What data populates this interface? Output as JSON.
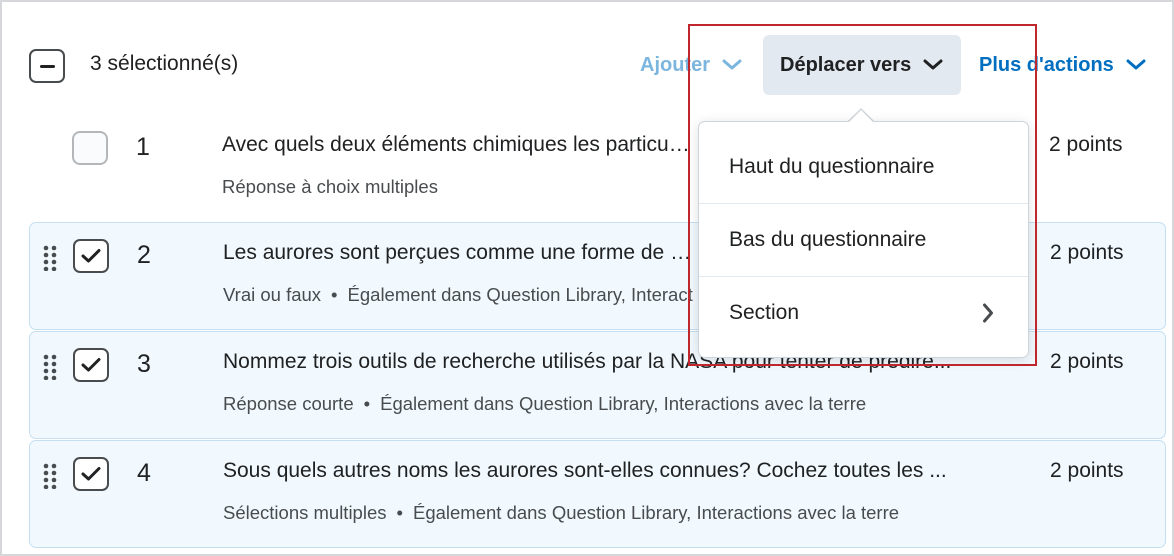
{
  "toolbar": {
    "selected_count": "3 sélectionné(s)",
    "add_label": "Ajouter",
    "move_label": "Déplacer vers",
    "more_label": "Plus d'actions"
  },
  "questions": [
    {
      "number": "1",
      "title": "Avec quels deux éléments chimiques les particules du vent solaire",
      "type": "Réponse à choix multiples",
      "also_in": "",
      "points": "2 points",
      "selected": false
    },
    {
      "number": "2",
      "title": "Les aurores sont perçues comme une forme de pollution lumineuse",
      "type": "Vrai ou faux",
      "also_in": "Également dans Question Library, Interactions avec la terre",
      "points": "2 points",
      "selected": true
    },
    {
      "number": "3",
      "title": "Nommez trois outils de recherche utilisés par la NASA pour tenter de prédire...",
      "type": "Réponse courte",
      "also_in": "Également dans Question Library, Interactions avec la terre",
      "points": "2 points",
      "selected": true
    },
    {
      "number": "4",
      "title": "Sous quels autres noms les aurores sont-elles connues? Cochez toutes les ...",
      "type": "Sélections multiples",
      "also_in": "Également dans Question Library, Interactions avec la terre",
      "points": "2 points",
      "selected": true
    }
  ],
  "move_menu": {
    "items": [
      {
        "label": "Haut du questionnaire"
      },
      {
        "label": "Bas du questionnaire"
      },
      {
        "label": "Section",
        "submenu": true
      }
    ]
  },
  "colors": {
    "accent": "#006fbf",
    "selected_row_bg": "#f1f9fe",
    "highlight_border": "#c0272d"
  }
}
